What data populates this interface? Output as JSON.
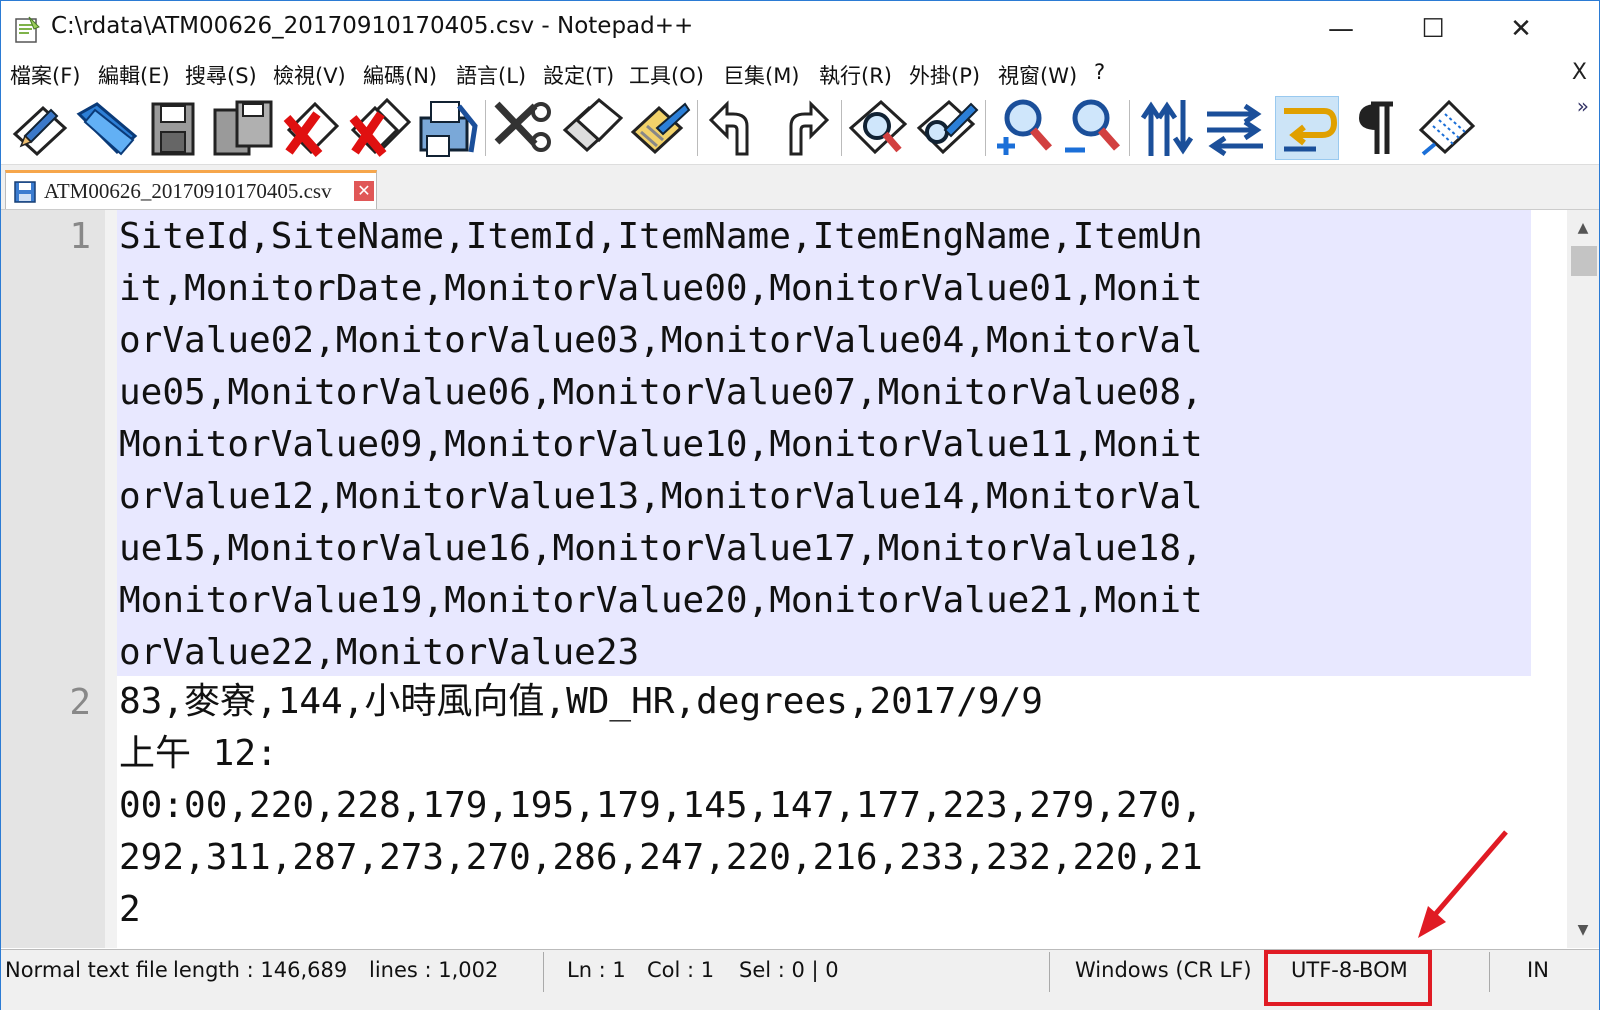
{
  "window": {
    "title": "C:\\rdata\\ATM00626_20170910170405.csv - Notepad++",
    "minimize": "—",
    "maximize": "☐",
    "close": "✕"
  },
  "menu": {
    "items": [
      "檔案(F)",
      "編輯(E)",
      "搜尋(S)",
      "檢視(V)",
      "編碼(N)",
      "語言(L)",
      "設定(T)",
      "工具(O)",
      "巨集(M)",
      "執行(R)",
      "外掛(P)",
      "視窗(W)",
      "?"
    ],
    "close": "X"
  },
  "toolbar": {
    "more": "»"
  },
  "tab": {
    "label": "ATM00626_20170910170405.csv",
    "close": "✕"
  },
  "editor": {
    "line_numbers": [
      "1",
      "2"
    ],
    "line1_rows": [
      "SiteId,SiteName,ItemId,ItemName,ItemEngName,ItemUn",
      "it,MonitorDate,MonitorValue00,MonitorValue01,Monit",
      "orValue02,MonitorValue03,MonitorValue04,MonitorVal",
      "ue05,MonitorValue06,MonitorValue07,MonitorValue08,",
      "MonitorValue09,MonitorValue10,MonitorValue11,Monit",
      "orValue12,MonitorValue13,MonitorValue14,MonitorVal",
      "ue15,MonitorValue16,MonitorValue17,MonitorValue18,",
      "MonitorValue19,MonitorValue20,MonitorValue21,Monit",
      "orValue22,MonitorValue23"
    ],
    "line2_rows": [
      "83,麥寮,144,小時風向值,WD_HR,degrees,2017/9/9",
      "上午 12:",
      "00:00,220,228,179,195,179,145,147,177,223,279,270,",
      "292,311,287,273,270,286,247,220,216,233,232,220,21",
      "2"
    ]
  },
  "status": {
    "type": "Normal text file",
    "length": "length : 146,689",
    "lines": "lines : 1,002",
    "ln": "Ln : 1",
    "col": "Col : 1",
    "sel": "Sel : 0 | 0",
    "eol": "Windows (CR LF)",
    "encoding": "UTF-8-BOM",
    "mode": "IN"
  },
  "colors": {
    "selection_line": "#e8e8ff",
    "annotation": "#e01b24",
    "tab_accent": "#f6a64b"
  }
}
